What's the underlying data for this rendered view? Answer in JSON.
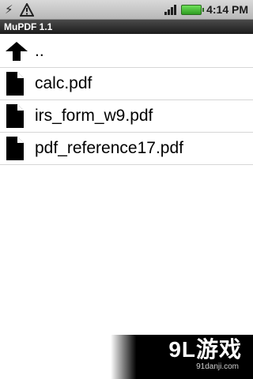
{
  "status_bar": {
    "icons": [
      "usb-icon",
      "warning-icon",
      "signal-icon",
      "battery-icon"
    ],
    "time": "4:14",
    "ampm": "PM",
    "battery_color": "#2f9d22"
  },
  "title_bar": {
    "title": "MuPDF 1.1"
  },
  "file_list": {
    "items": [
      {
        "icon": "up-arrow-icon",
        "label": ".."
      },
      {
        "icon": "document-icon",
        "label": "calc.pdf"
      },
      {
        "icon": "document-icon",
        "label": "irs_form_w9.pdf"
      },
      {
        "icon": "document-icon",
        "label": "pdf_reference17.pdf"
      }
    ]
  },
  "watermark": {
    "brand": "9L游戏",
    "url": "91danji.com"
  }
}
